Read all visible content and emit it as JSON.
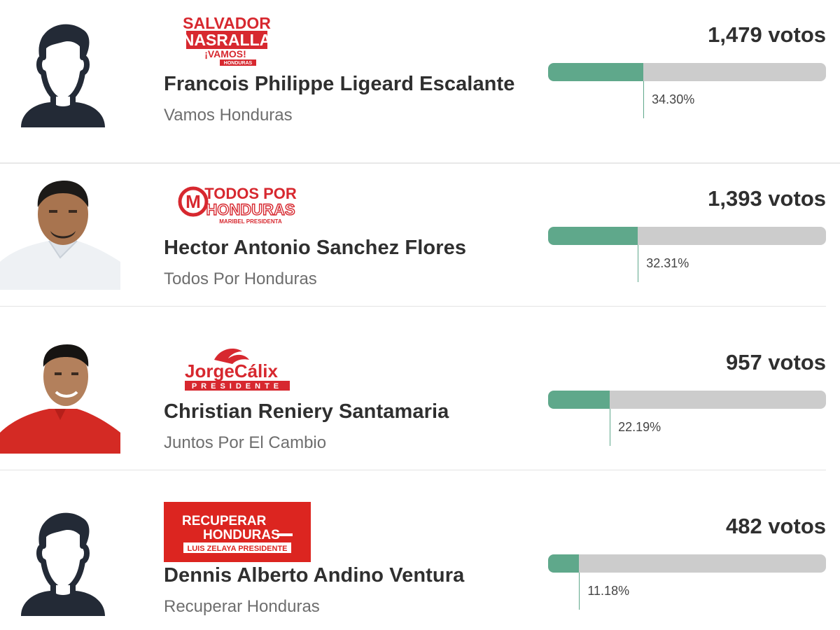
{
  "candidates": [
    {
      "name": "Francois Philippe Ligeard Escalante",
      "party": "Vamos Honduras",
      "votes": "1,479 votos",
      "percent_label": "34.30%",
      "percent": 34.3,
      "avatar": "silhouette-icon",
      "logo": {
        "line1": "SALVADOR",
        "line2": "NASRALLA",
        "line3": "¡VAMOS!",
        "line4": "HONDURAS",
        "color": "#d7282f"
      }
    },
    {
      "name": "Hector Antonio Sanchez Flores",
      "party": "Todos Por Honduras",
      "votes": "1,393 votos",
      "percent_label": "32.31%",
      "percent": 32.31,
      "avatar": "photo",
      "logo": {
        "mark": "M",
        "line1": "TODOS POR",
        "line2": "HONDURAS",
        "line3": "MARIBEL PRESIDENTA",
        "color": "#d7282f"
      }
    },
    {
      "name": "Christian Reniery Santamaria",
      "party": "Juntos Por El Cambio",
      "votes": "957 votos",
      "percent_label": "22.19%",
      "percent": 22.19,
      "avatar": "photo",
      "logo": {
        "line1": "JorgeCálix",
        "line2": "PRESIDENTE",
        "color": "#d7282f"
      }
    },
    {
      "name": "Dennis Alberto Andino Ventura",
      "party": "Recuperar Honduras",
      "votes": "482 votos",
      "percent_label": "11.18%",
      "percent": 11.18,
      "avatar": "silhouette-icon",
      "logo": {
        "line1": "RECUPERAR",
        "line2": "HONDURAS",
        "line3": "LUIS ZELAYA PRESIDENTE",
        "color": "#dc2520"
      }
    }
  ],
  "colors": {
    "bar_fill": "#5fa88b",
    "bar_track": "#cccccc",
    "text_dark": "#2f2f2f",
    "text_muted": "#6e6e6e"
  }
}
